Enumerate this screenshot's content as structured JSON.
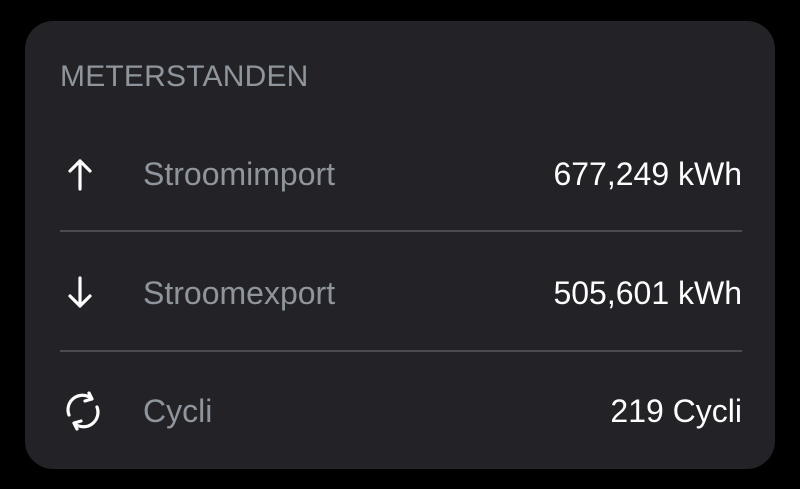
{
  "card": {
    "title": "METERSTANDEN",
    "rows": [
      {
        "icon": "arrow-up-icon",
        "label": "Stroomimport",
        "value": "677,249 kWh"
      },
      {
        "icon": "arrow-down-icon",
        "label": "Stroomexport",
        "value": "505,601 kWh"
      },
      {
        "icon": "cycle-icon",
        "label": "Cycli",
        "value": "219 Cycli"
      }
    ]
  },
  "colors": {
    "background": "#000000",
    "card": "#232227",
    "label": "#8f959c",
    "value": "#ffffff",
    "divider": "#4a4a50"
  }
}
